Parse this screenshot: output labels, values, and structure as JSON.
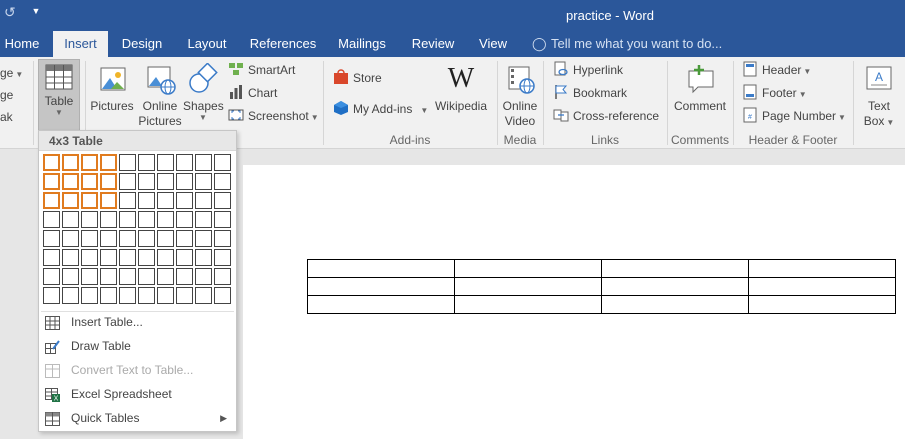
{
  "window": {
    "title": "practice - Word"
  },
  "tabs": [
    {
      "label": "Home"
    },
    {
      "label": "Insert"
    },
    {
      "label": "Design"
    },
    {
      "label": "Layout"
    },
    {
      "label": "References"
    },
    {
      "label": "Mailings"
    },
    {
      "label": "Review"
    },
    {
      "label": "View"
    }
  ],
  "tell_me": {
    "placeholder": "Tell me what you want to do..."
  },
  "ribbon": {
    "pages_partial": [
      "ge",
      "ge",
      "ak"
    ],
    "table": {
      "label": "Table"
    },
    "pictures": {
      "label": "Pictures"
    },
    "online_pictures": {
      "label1": "Online",
      "label2": "Pictures"
    },
    "shapes": {
      "label": "Shapes"
    },
    "smartart": {
      "label": "SmartArt"
    },
    "chart": {
      "label": "Chart"
    },
    "screenshot": {
      "label": "Screenshot"
    },
    "store": {
      "label": "Store"
    },
    "my_addins": {
      "label": "My Add-ins"
    },
    "wikipedia": {
      "label": "Wikipedia"
    },
    "addins_group": {
      "label": "Add-ins"
    },
    "online_video": {
      "label1": "Online",
      "label2": "Video"
    },
    "media_group": {
      "label": "Media"
    },
    "hyperlink": {
      "label": "Hyperlink"
    },
    "bookmark": {
      "label": "Bookmark"
    },
    "cross_reference": {
      "label": "Cross-reference"
    },
    "links_group": {
      "label": "Links"
    },
    "comment": {
      "label": "Comment"
    },
    "comments_group": {
      "label": "Comments"
    },
    "header": {
      "label": "Header"
    },
    "footer": {
      "label": "Footer"
    },
    "page_number": {
      "label": "Page Number"
    },
    "header_footer_group": {
      "label": "Header & Footer"
    },
    "text_box": {
      "label1": "Text",
      "label2": "Box"
    }
  },
  "table_menu": {
    "heading": "4x3 Table",
    "grid_cols": 10,
    "grid_rows": 8,
    "selected_cols": 4,
    "selected_rows": 3,
    "items": [
      {
        "label": "Insert Table...",
        "icon": "insert-table-icon",
        "disabled": false
      },
      {
        "label": "Draw Table",
        "icon": "draw-table-icon",
        "disabled": false
      },
      {
        "label": "Convert Text to Table...",
        "icon": "convert-text-icon",
        "disabled": true
      },
      {
        "label": "Excel Spreadsheet",
        "icon": "excel-icon",
        "disabled": false
      },
      {
        "label": "Quick Tables",
        "icon": "quick-tables-icon",
        "disabled": false,
        "submenu": true
      }
    ]
  },
  "document": {
    "table_cols": 4,
    "table_rows": 3
  },
  "colors": {
    "brand": "#2b579a",
    "grid_highlight": "#e07b1f"
  }
}
